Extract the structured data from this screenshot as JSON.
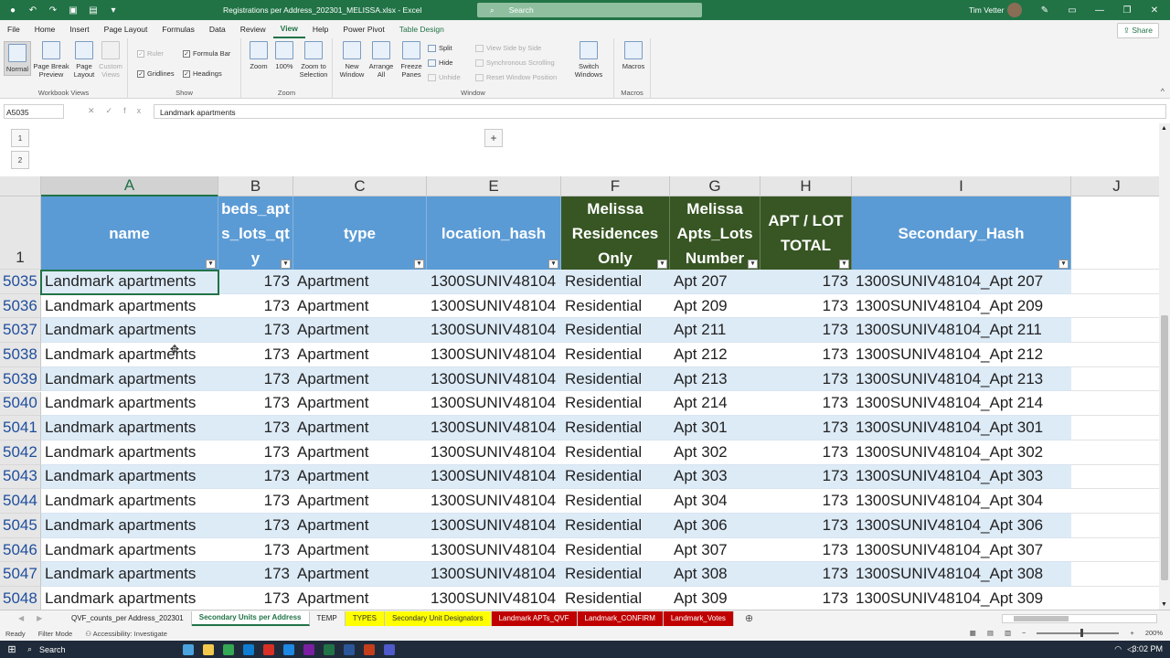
{
  "titlebar": {
    "doc_title": "Registrations per Address_202301_MELISSA.xlsx  -  Excel",
    "search_label": "Search",
    "user": "Tim Vetter"
  },
  "menu": {
    "tabs": [
      "File",
      "Home",
      "Insert",
      "Page Layout",
      "Formulas",
      "Data",
      "Review",
      "View",
      "Help",
      "Power Pivot",
      "Table Design"
    ],
    "active": "View",
    "share": "Share"
  },
  "ribbon": {
    "workbook_views": {
      "label": "Workbook Views",
      "normal": "Normal",
      "page_break": "Page Break Preview",
      "page_layout": "Page Layout",
      "custom_views": "Custom Views"
    },
    "show": {
      "label": "Show",
      "ruler": "Ruler",
      "formula_bar": "Formula Bar",
      "gridlines": "Gridlines",
      "headings": "Headings"
    },
    "zoom": {
      "label": "Zoom",
      "zoom": "Zoom",
      "hundred": "100%",
      "zoom_sel": "Zoom to Selection"
    },
    "window": {
      "label": "Window",
      "new_window": "New Window",
      "arrange_all": "Arrange All",
      "freeze_panes": "Freeze Panes",
      "split": "Split",
      "hide": "Hide",
      "unhide": "Unhide",
      "side_by_side": "View Side by Side",
      "sync_scroll": "Synchronous Scrolling",
      "reset_pos": "Reset Window Position",
      "switch": "Switch Windows"
    },
    "macros": {
      "label": "Macros",
      "macros": "Macros"
    }
  },
  "formula_bar": {
    "name_box": "A5035",
    "fx": "fx",
    "formula": "Landmark apartments"
  },
  "outline": {
    "levels": [
      "1",
      "2"
    ],
    "expand": "+"
  },
  "grid": {
    "columns": [
      "A",
      "B",
      "C",
      "E",
      "F",
      "G",
      "H",
      "I",
      "J"
    ],
    "header_row_number": "1",
    "headers": {
      "a": "name",
      "b": "beds_apts_lots_qty",
      "c": "type",
      "e": "location_hash",
      "f": "Melissa Residences Only",
      "g": "Melissa Apts_Lots Number",
      "h": "APT / LOT TOTAL",
      "i": "Secondary_Hash"
    },
    "rows": [
      {
        "n": "5035",
        "a": "Landmark apartments",
        "b": "173",
        "c": "Apartment",
        "e": "1300SUNIV48104",
        "f": "Residential",
        "g": "Apt 207",
        "h": "173",
        "i": "1300SUNIV48104_Apt 207"
      },
      {
        "n": "5036",
        "a": "Landmark apartments",
        "b": "173",
        "c": "Apartment",
        "e": "1300SUNIV48104",
        "f": "Residential",
        "g": "Apt 209",
        "h": "173",
        "i": "1300SUNIV48104_Apt 209"
      },
      {
        "n": "5037",
        "a": "Landmark apartments",
        "b": "173",
        "c": "Apartment",
        "e": "1300SUNIV48104",
        "f": "Residential",
        "g": "Apt 211",
        "h": "173",
        "i": "1300SUNIV48104_Apt 211"
      },
      {
        "n": "5038",
        "a": "Landmark apartments",
        "b": "173",
        "c": "Apartment",
        "e": "1300SUNIV48104",
        "f": "Residential",
        "g": "Apt 212",
        "h": "173",
        "i": "1300SUNIV48104_Apt 212"
      },
      {
        "n": "5039",
        "a": "Landmark apartments",
        "b": "173",
        "c": "Apartment",
        "e": "1300SUNIV48104",
        "f": "Residential",
        "g": "Apt 213",
        "h": "173",
        "i": "1300SUNIV48104_Apt 213"
      },
      {
        "n": "5040",
        "a": "Landmark apartments",
        "b": "173",
        "c": "Apartment",
        "e": "1300SUNIV48104",
        "f": "Residential",
        "g": "Apt 214",
        "h": "173",
        "i": "1300SUNIV48104_Apt 214"
      },
      {
        "n": "5041",
        "a": "Landmark apartments",
        "b": "173",
        "c": "Apartment",
        "e": "1300SUNIV48104",
        "f": "Residential",
        "g": "Apt 301",
        "h": "173",
        "i": "1300SUNIV48104_Apt 301"
      },
      {
        "n": "5042",
        "a": "Landmark apartments",
        "b": "173",
        "c": "Apartment",
        "e": "1300SUNIV48104",
        "f": "Residential",
        "g": "Apt 302",
        "h": "173",
        "i": "1300SUNIV48104_Apt 302"
      },
      {
        "n": "5043",
        "a": "Landmark apartments",
        "b": "173",
        "c": "Apartment",
        "e": "1300SUNIV48104",
        "f": "Residential",
        "g": "Apt 303",
        "h": "173",
        "i": "1300SUNIV48104_Apt 303"
      },
      {
        "n": "5044",
        "a": "Landmark apartments",
        "b": "173",
        "c": "Apartment",
        "e": "1300SUNIV48104",
        "f": "Residential",
        "g": "Apt 304",
        "h": "173",
        "i": "1300SUNIV48104_Apt 304"
      },
      {
        "n": "5045",
        "a": "Landmark apartments",
        "b": "173",
        "c": "Apartment",
        "e": "1300SUNIV48104",
        "f": "Residential",
        "g": "Apt 306",
        "h": "173",
        "i": "1300SUNIV48104_Apt 306"
      },
      {
        "n": "5046",
        "a": "Landmark apartments",
        "b": "173",
        "c": "Apartment",
        "e": "1300SUNIV48104",
        "f": "Residential",
        "g": "Apt 307",
        "h": "173",
        "i": "1300SUNIV48104_Apt 307"
      },
      {
        "n": "5047",
        "a": "Landmark apartments",
        "b": "173",
        "c": "Apartment",
        "e": "1300SUNIV48104",
        "f": "Residential",
        "g": "Apt 308",
        "h": "173",
        "i": "1300SUNIV48104_Apt 308"
      },
      {
        "n": "5048",
        "a": "Landmark apartments",
        "b": "173",
        "c": "Apartment",
        "e": "1300SUNIV48104",
        "f": "Residential",
        "g": "Apt 309",
        "h": "173",
        "i": "1300SUNIV48104_Apt 309"
      }
    ]
  },
  "sheets": [
    {
      "name": "QVF_counts_per Address_202301",
      "style": "normal"
    },
    {
      "name": "Secondary Units per Address",
      "style": "active"
    },
    {
      "name": "TEMP",
      "style": "normal"
    },
    {
      "name": "TYPES",
      "style": "yellow"
    },
    {
      "name": "Secondary Unit Designators",
      "style": "yellow"
    },
    {
      "name": "Landmark APTs_QVF",
      "style": "red"
    },
    {
      "name": "Landmark_CONFIRM",
      "style": "red"
    },
    {
      "name": "Landmark_Votes",
      "style": "red"
    }
  ],
  "status": {
    "ready": "Ready",
    "filter_mode": "Filter Mode",
    "accessibility": "Accessibility: Investigate",
    "zoom": "200%"
  },
  "taskbar": {
    "search": "Search",
    "time": "3:02 PM"
  },
  "colors": {
    "excel_green": "#217346",
    "header_blue": "#5b9bd5",
    "header_dark_green": "#375623",
    "band_blue": "#ddebf7",
    "tab_yellow": "#ffff00",
    "tab_red": "#c00000"
  }
}
